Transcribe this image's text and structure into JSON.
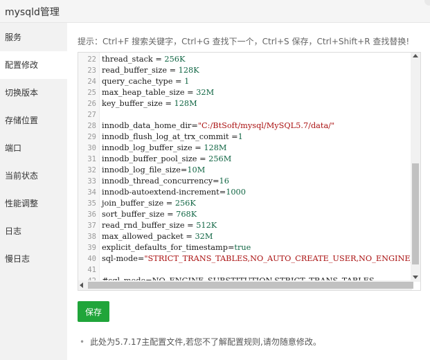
{
  "window": {
    "title": "mysqld管理"
  },
  "sidebar": {
    "items": [
      {
        "label": "服务",
        "active": false
      },
      {
        "label": "配置修改",
        "active": true
      },
      {
        "label": "切换版本",
        "active": false
      },
      {
        "label": "存储位置",
        "active": false
      },
      {
        "label": "端口",
        "active": false
      },
      {
        "label": "当前状态",
        "active": false
      },
      {
        "label": "性能调整",
        "active": false
      },
      {
        "label": "日志",
        "active": false
      },
      {
        "label": "慢日志",
        "active": false
      }
    ]
  },
  "main": {
    "hint": "提示：Ctrl+F 搜索关键字，Ctrl+G 查找下一个，Ctrl+S 保存，Ctrl+Shift+R 查找替换!",
    "editor": {
      "lines": [
        {
          "n": "22",
          "text": "thread_stack = 256K"
        },
        {
          "n": "23",
          "text": "read_buffer_size = 128K"
        },
        {
          "n": "24",
          "text": "query_cache_type = 1"
        },
        {
          "n": "25",
          "text": "max_heap_table_size = 32M"
        },
        {
          "n": "26",
          "text": "key_buffer_size = 128M"
        },
        {
          "n": "27",
          "text": ""
        },
        {
          "n": "28",
          "text": "innodb_data_home_dir=\"C:/BtSoft/mysql/MySQL5.7/data/\""
        },
        {
          "n": "29",
          "text": "innodb_flush_log_at_trx_commit =1"
        },
        {
          "n": "30",
          "text": "innodb_log_buffer_size = 128M"
        },
        {
          "n": "31",
          "text": "innodb_buffer_pool_size = 256M"
        },
        {
          "n": "32",
          "text": "innodb_log_file_size=10M"
        },
        {
          "n": "33",
          "text": "innodb_thread_concurrency=16"
        },
        {
          "n": "34",
          "text": "innodb-autoextend-increment=1000"
        },
        {
          "n": "35",
          "text": "join_buffer_size = 256K"
        },
        {
          "n": "36",
          "text": "sort_buffer_size = 768K"
        },
        {
          "n": "37",
          "text": "read_rnd_buffer_size = 512K"
        },
        {
          "n": "38",
          "text": "max_allowed_packet = 32M"
        },
        {
          "n": "39",
          "text": "explicit_defaults_for_timestamp=true"
        },
        {
          "n": "40",
          "text": "sql-mode=\"STRICT_TRANS_TABLES,NO_AUTO_CREATE_USER,NO_ENGINE_SUBSTITUTION\""
        },
        {
          "n": "41",
          "text": ""
        },
        {
          "n": "42",
          "text": "#sql_mode=NO_ENGINE_SUBSTITUTION,STRICT_TRANS_TABLES"
        }
      ]
    },
    "save_label": "保存",
    "note": "此处为5.7.17主配置文件,若您不了解配置规则,请勿随意修改。"
  },
  "colors": {
    "accent": "#20a53a",
    "number": "#116644",
    "string": "#aa1111"
  }
}
